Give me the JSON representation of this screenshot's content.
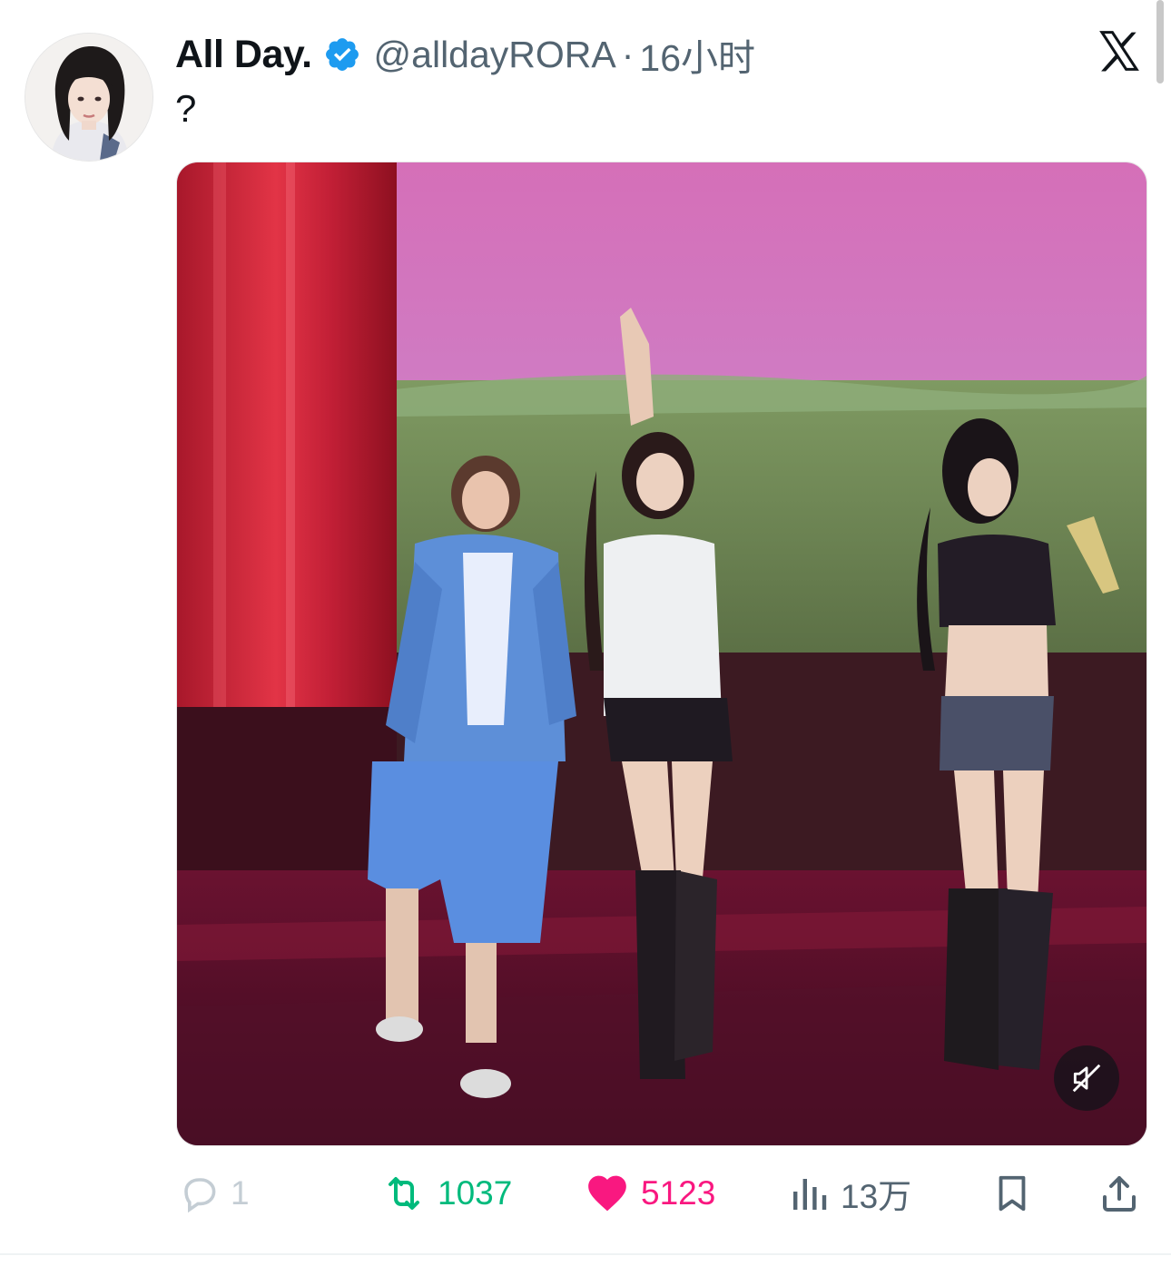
{
  "tweet": {
    "display_name": "All Day.",
    "verified_icon": "verified-badge-icon",
    "handle": "@alldayRORA",
    "separator": "·",
    "time_ago": "16小时",
    "text": "?"
  },
  "media": {
    "type": "video",
    "mute_icon": "speaker-muted-icon"
  },
  "actions": {
    "reply": {
      "icon": "reply-bubble-icon",
      "count": "1"
    },
    "retweet": {
      "icon": "retweet-icon",
      "count": "1037"
    },
    "like": {
      "icon": "heart-filled-icon",
      "count": "5123"
    },
    "views": {
      "icon": "views-bar-chart-icon",
      "count": "13万"
    },
    "bookmark": {
      "icon": "bookmark-icon"
    },
    "share": {
      "icon": "share-upload-icon"
    }
  },
  "brand": {
    "logo": "x-logo-icon"
  },
  "colors": {
    "text": "#0f1419",
    "secondary": "#536471",
    "verified": "#1d9bf0",
    "retweet": "#00ba7c",
    "like": "#f91880"
  }
}
